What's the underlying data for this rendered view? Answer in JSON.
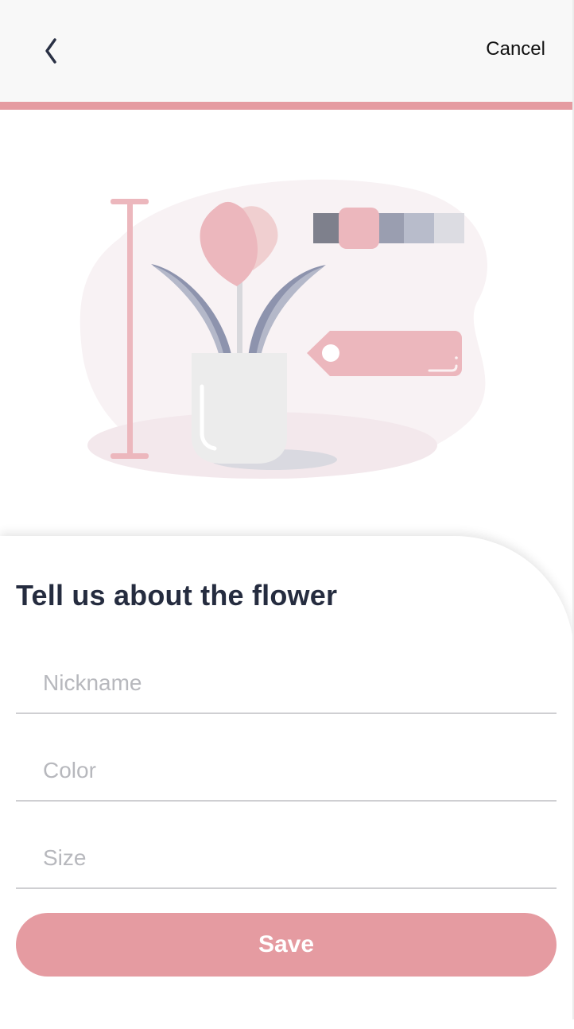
{
  "header": {
    "back_icon": "chevron-left-icon",
    "cancel_label": "Cancel"
  },
  "illustration": {
    "name": "flower-vase-illustration",
    "swatch_colors": [
      "#7e808c",
      "#ecb7bd",
      "#9a9eb0",
      "#b8bccb",
      "#dcdce2"
    ]
  },
  "form": {
    "title": "Tell us about the flower",
    "fields": [
      {
        "placeholder": "Nickname",
        "value": ""
      },
      {
        "placeholder": "Color",
        "value": ""
      },
      {
        "placeholder": "Size",
        "value": ""
      }
    ],
    "save_label": "Save"
  },
  "colors": {
    "accent": "#e59ba1",
    "title": "#252c3f",
    "header_bg": "#f8f8f8"
  }
}
